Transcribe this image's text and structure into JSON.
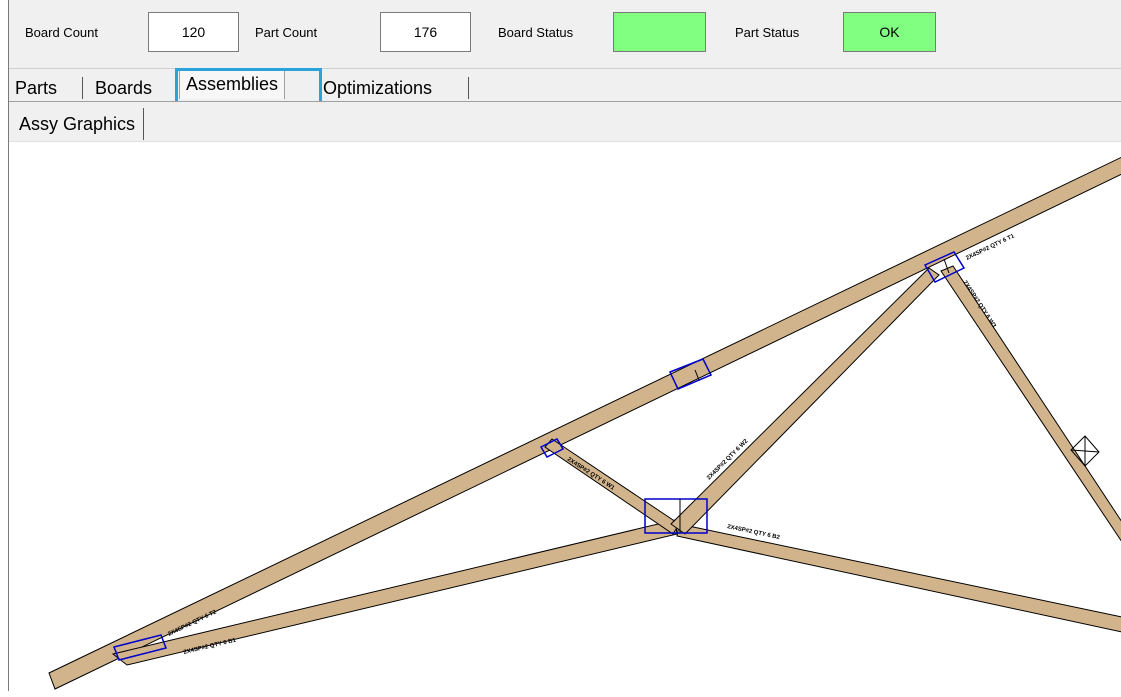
{
  "header": {
    "board_count_label": "Board Count",
    "board_count_value": "120",
    "part_count_label": "Part Count",
    "part_count_value": "176",
    "board_status_label": "Board Status",
    "board_status_color": "#80ff80",
    "part_status_label": "Part Status",
    "part_status_value": "OK",
    "part_status_color": "#80ff80"
  },
  "tabs": [
    {
      "label": "Parts"
    },
    {
      "label": "Boards"
    },
    {
      "label": "Assemblies",
      "active": true
    },
    {
      "label": "Optimizations"
    }
  ],
  "subtabs": [
    {
      "label": "Assy Graphics",
      "active": true
    }
  ],
  "graphics": {
    "member_color": "#d2b48c",
    "plate_color": "#0000cc",
    "top_chord_label": "2X4SP#2 QTY 6 T1",
    "top_chord_label_2": "2X4SP#2 QTY 6 T2",
    "bottom_chord_label": "2X4SP#2 QTY 6 B1",
    "bottom_chord_label_2": "2X4SP#2 QTY 6 B2",
    "web_label_1": "2X4SP#2 QTY 6 W1",
    "web_label_2": "2X4SP#2 QTY 6 W2",
    "web_label_3": "2X4SP#2 QTY 6 W3"
  }
}
